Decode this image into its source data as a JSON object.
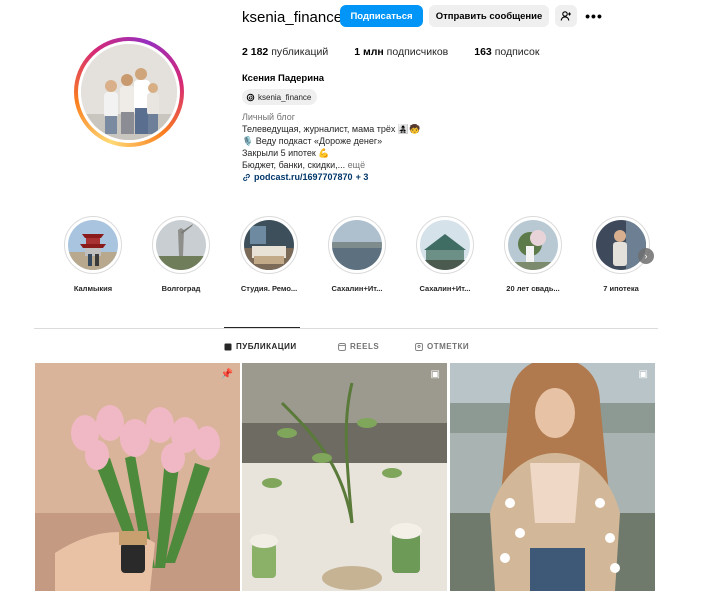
{
  "profile": {
    "username": "ksenia_finance",
    "full_name": "Ксения Падерина",
    "threads_handle": "ksenia_finance",
    "avatar_icon": "profile-avatar"
  },
  "actions": {
    "follow_label": "Подписаться",
    "message_label": "Отправить сообщение",
    "suggest_icon": "person-add-icon",
    "more_icon": "more-horizontal-icon",
    "more_glyph": "•••"
  },
  "stats": {
    "posts_value": "2 182",
    "posts_label": "публикаций",
    "followers_value": "1 млн",
    "followers_label": "подписчиков",
    "following_value": "163",
    "following_label": "подписок"
  },
  "bio": {
    "category": "Личный блог",
    "line1": "Телеведущая, журналист, мама трёх 👩‍👧‍👦🧒",
    "line2": "🎙️ Веду подкаст «Дороже денег»",
    "line3": "Закрыли 5 ипотек 💪",
    "line4": "Бюджет, банки, скидки,...",
    "more_label": "ещё",
    "link_text": "podcast.ru/1697707870",
    "link_extra": "+ 3"
  },
  "highlights": [
    {
      "label": "Калмыкия"
    },
    {
      "label": "Волгоград"
    },
    {
      "label": "Студия. Ремо..."
    },
    {
      "label": "Сахалин+Ит..."
    },
    {
      "label": "Сахалин+Ит..."
    },
    {
      "label": "20 лет свадь..."
    },
    {
      "label": "7 ипотека"
    }
  ],
  "tabs": {
    "posts": "ПУБЛИКАЦИИ",
    "reels": "REELS",
    "tagged": "ОТМЕТКИ"
  },
  "colors": {
    "accent": "#0095f6",
    "link": "#00376b"
  }
}
